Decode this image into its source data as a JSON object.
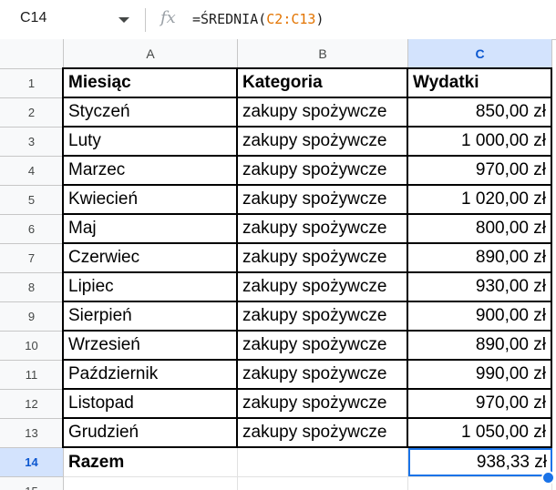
{
  "name_box": "C14",
  "formula": {
    "prefix": "=ŚREDNIA(",
    "range": "C2:C13",
    "suffix": ")"
  },
  "fx_label": "fx",
  "columns": [
    "A",
    "B",
    "C"
  ],
  "selected_cell": "C14",
  "rows": [
    {
      "n": "1",
      "a": "Miesiąc",
      "b": "Kategoria",
      "c": "Wydatki"
    },
    {
      "n": "2",
      "a": "Styczeń",
      "b": "zakupy spożywcze",
      "c": "850,00 zł"
    },
    {
      "n": "3",
      "a": "Luty",
      "b": "zakupy spożywcze",
      "c": "1 000,00 zł"
    },
    {
      "n": "4",
      "a": "Marzec",
      "b": "zakupy spożywcze",
      "c": "970,00 zł"
    },
    {
      "n": "5",
      "a": "Kwiecień",
      "b": "zakupy spożywcze",
      "c": "1 020,00 zł"
    },
    {
      "n": "6",
      "a": "Maj",
      "b": "zakupy spożywcze",
      "c": "800,00 zł"
    },
    {
      "n": "7",
      "a": "Czerwiec",
      "b": "zakupy spożywcze",
      "c": "890,00 zł"
    },
    {
      "n": "8",
      "a": "Lipiec",
      "b": "zakupy spożywcze",
      "c": "930,00 zł"
    },
    {
      "n": "9",
      "a": "Sierpień",
      "b": "zakupy spożywcze",
      "c": "900,00 zł"
    },
    {
      "n": "10",
      "a": "Wrzesień",
      "b": "zakupy spożywcze",
      "c": "890,00 zł"
    },
    {
      "n": "11",
      "a": "Październik",
      "b": "zakupy spożywcze",
      "c": "990,00 zł"
    },
    {
      "n": "12",
      "a": "Listopad",
      "b": "zakupy spożywcze",
      "c": "970,00 zł"
    },
    {
      "n": "13",
      "a": "Grudzień",
      "b": "zakupy spożywcze",
      "c": "1 050,00 zł"
    },
    {
      "n": "14",
      "a": "Razem",
      "b": "",
      "c": "938,33 zł"
    },
    {
      "n": "15",
      "a": "",
      "b": "",
      "c": ""
    }
  ],
  "colors": {
    "selection": "#1a73e8",
    "header_selected": "#d3e3fd",
    "formula_ref": "#e37400"
  }
}
